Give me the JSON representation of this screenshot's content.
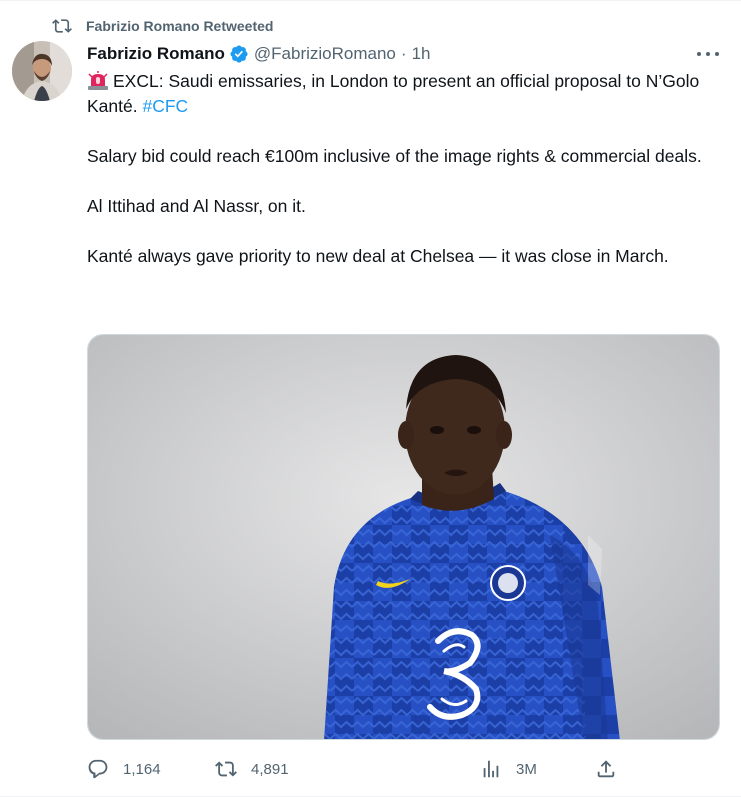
{
  "retweet_banner": {
    "text": "Fabrizio Romano Retweeted"
  },
  "author": {
    "name": "Fabrizio Romano",
    "handle": "@FabrizioRomano",
    "separator": "·",
    "time": "1h",
    "verified": true
  },
  "tweet": {
    "paragraphs": [
      {
        "prefix_icon": "police-siren-emoji",
        "text": "EXCL: Saudi emissaries, in London to present an official proposal to N’Golo Kanté.",
        "hashtag": "#CFC"
      },
      {
        "text": "Salary bid could reach €100m inclusive of the image rights & commercial deals."
      },
      {
        "text": "Al Ittihad and Al Nassr, on it."
      },
      {
        "text": "Kanté always gave priority to new deal at Chelsea — it was close in March."
      }
    ]
  },
  "media": {
    "sponsor_logo": "3"
  },
  "actions": {
    "replies": "1,164",
    "retweets": "4,891",
    "views": "3M"
  },
  "colors": {
    "link": "#1d9bf0",
    "secondary_text": "#536471",
    "verified": "#1d9bf0",
    "border": "#cfd9de"
  }
}
